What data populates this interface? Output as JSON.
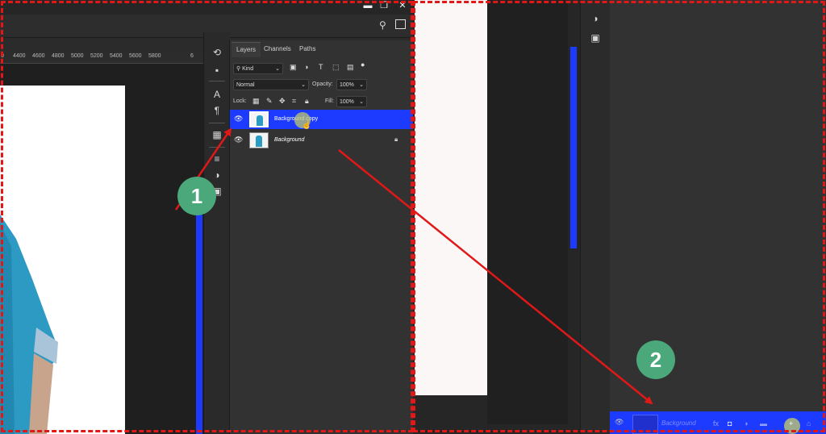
{
  "ruler": {
    "ticks": [
      "4400",
      "4600",
      "4800",
      "5000",
      "5200",
      "5400",
      "5600",
      "5800",
      "6"
    ]
  },
  "panel": {
    "tabs": [
      "Layers",
      "Channels",
      "Paths"
    ],
    "filter_kind": "Kind",
    "blend_mode": "Normal",
    "opacity_label": "Opacity:",
    "opacity_value": "100%",
    "lock_label": "Lock:",
    "fill_label": "Fill:",
    "fill_value": "100%",
    "layers": [
      {
        "name": "Background copy",
        "selected": true
      },
      {
        "name": "Background",
        "locked": true
      }
    ]
  },
  "right_panel": {
    "layer_name": "Background"
  },
  "annotations": {
    "step1": "1",
    "step2": "2"
  },
  "colors": {
    "selection": "#1d3bff",
    "annotation_red": "#e01818",
    "badge": "#4aa87b"
  }
}
